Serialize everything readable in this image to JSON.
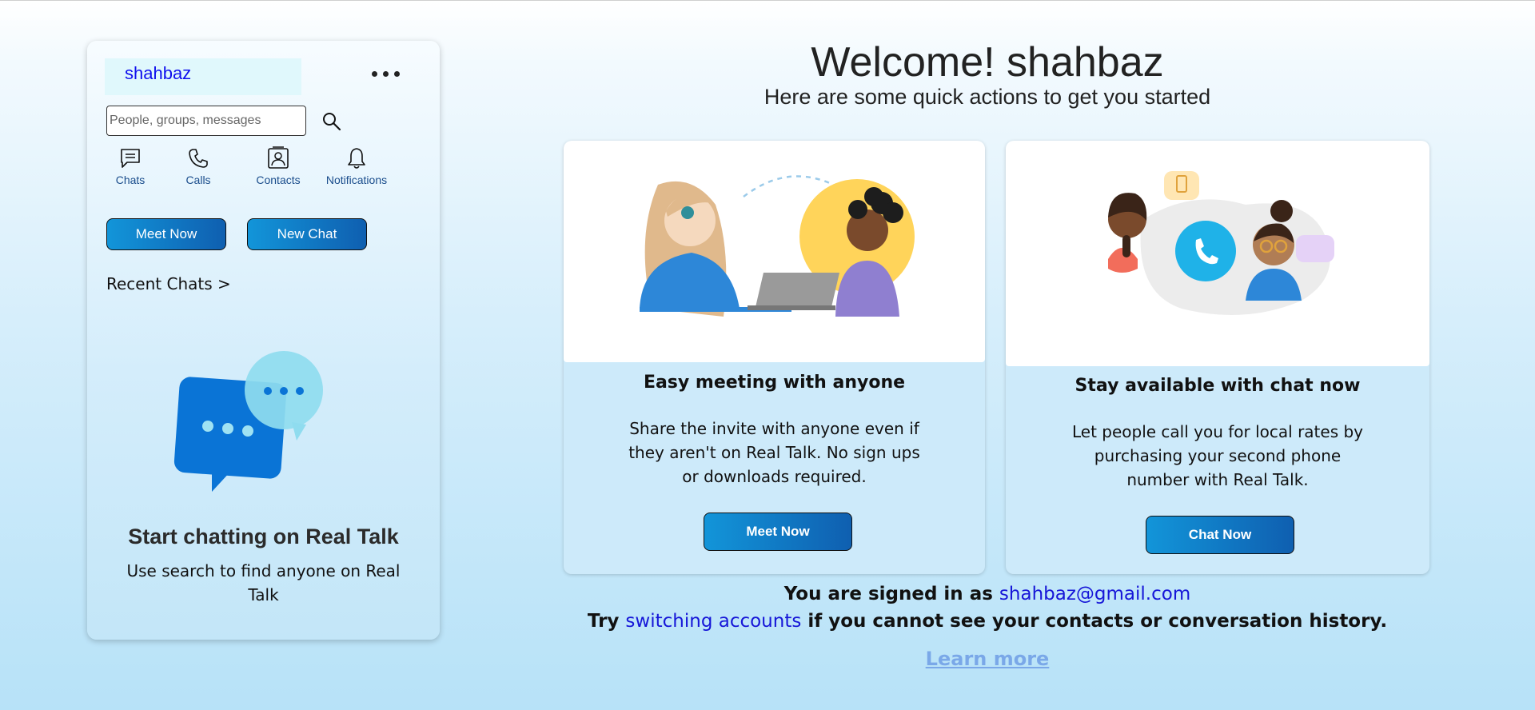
{
  "sidebar": {
    "user_name": "shahbaz",
    "search_placeholder": "People, groups, messages",
    "nav": [
      {
        "label": "Chats",
        "icon": "chat-icon"
      },
      {
        "label": "Calls",
        "icon": "phone-icon"
      },
      {
        "label": "Contacts",
        "icon": "contacts-icon"
      },
      {
        "label": "Notifications",
        "icon": "bell-icon"
      }
    ],
    "meet_now_label": "Meet Now",
    "new_chat_label": "New Chat",
    "recent_chats_label": "Recent Chats >",
    "empty_title": "Start chatting on Real Talk",
    "empty_subtitle": "Use search to find anyone on Real Talk"
  },
  "welcome": {
    "title": "Welcome! shahbaz",
    "subtitle": "Here are some quick actions to get you started"
  },
  "cards": [
    {
      "title": "Easy meeting with anyone",
      "text": "Share the invite with anyone even if they aren't on Real Talk. No sign ups or downloads required.",
      "button": "Meet Now"
    },
    {
      "title": "Stay available with chat now",
      "text": "Let people call you for local rates by purchasing your second phone number with Real Talk.",
      "button": "Chat Now"
    }
  ],
  "footer": {
    "signed_in_prefix": "You are signed in as",
    "email": "shahbaz@gmail.com",
    "try_prefix": "Try",
    "switch_link": "switching accounts",
    "try_suffix": "if you cannot see your contacts or conversation history.",
    "learn_more": "Learn more"
  },
  "colors": {
    "accent_blue": "#1295d9",
    "link_blue": "#1616d8",
    "learn_more": "#7aa8e8"
  }
}
